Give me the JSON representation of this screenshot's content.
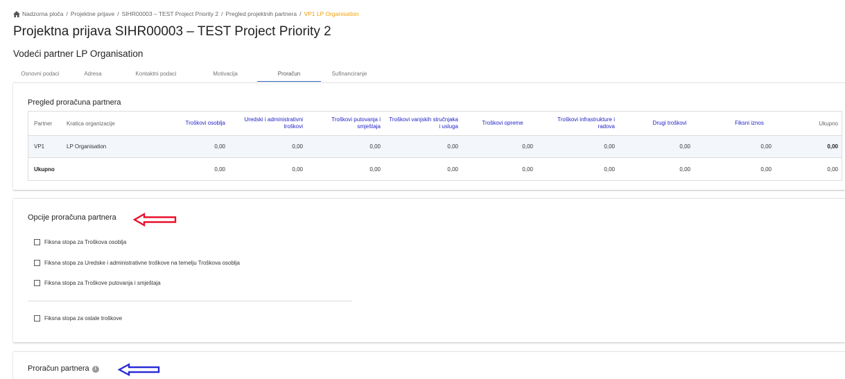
{
  "breadcrumb": {
    "items": [
      "Nadzorna ploča",
      "Projektne prijave",
      "SIHR00003 – TEST Project Priority 2",
      "Pregled projektnih partnera"
    ],
    "current": "VP1 LP Organisation",
    "separator": "/"
  },
  "page": {
    "title": "Projektna prijava SIHR00003 – TEST Project Priority 2",
    "subtitle": "Vodeći partner LP Organisation"
  },
  "tabs": [
    "Osnovni podaci",
    "Adresa",
    "Kontaktni podaci",
    "Motivacija",
    "Proračun",
    "Sufinanciranje"
  ],
  "active_tab": "Proračun",
  "overview": {
    "title": "Pregled proračuna partnera",
    "columns": [
      "Partner",
      "Kratica organizacije",
      "Troškovi osoblja",
      "Uredski i administrativni troškovi",
      "Troškovi putovanja i smještaja",
      "Troškovi vanjskih stručnjaka i usluga",
      "Troškovi opreme",
      "Troškovi infrastrukture i radova",
      "Drugi troškovi",
      "Fiksni iznos",
      "Ukupno"
    ],
    "rows": [
      [
        "VP1",
        "LP Organisation",
        "0,00",
        "0,00",
        "0,00",
        "0,00",
        "0,00",
        "0,00",
        "0,00",
        "0,00",
        "0,00"
      ],
      [
        "Ukupno",
        "",
        "0,00",
        "0,00",
        "0,00",
        "0,00",
        "0,00",
        "0,00",
        "0,00",
        "0,00",
        "0,00"
      ]
    ]
  },
  "options": {
    "title": "Opcije proračuna partnera",
    "items": [
      "Fiksna stopa za Troškova osoblja",
      "Fiksna stopa za Uredske i administrativne troškove na temelju Troškova osoblja",
      "Fiksna stopa za Troškove putovanja i smještaja",
      "Fiksna stopa za ostale troškove"
    ]
  },
  "budget": {
    "title": "Proračun partnera",
    "info_glyph": "i"
  },
  "colors": {
    "accent": "#2f67b8",
    "breadcrumb_current": "#f2a100",
    "header_link": "#2323c8",
    "annotation_red": "#e8112d",
    "annotation_blue": "#2b2bd6"
  }
}
